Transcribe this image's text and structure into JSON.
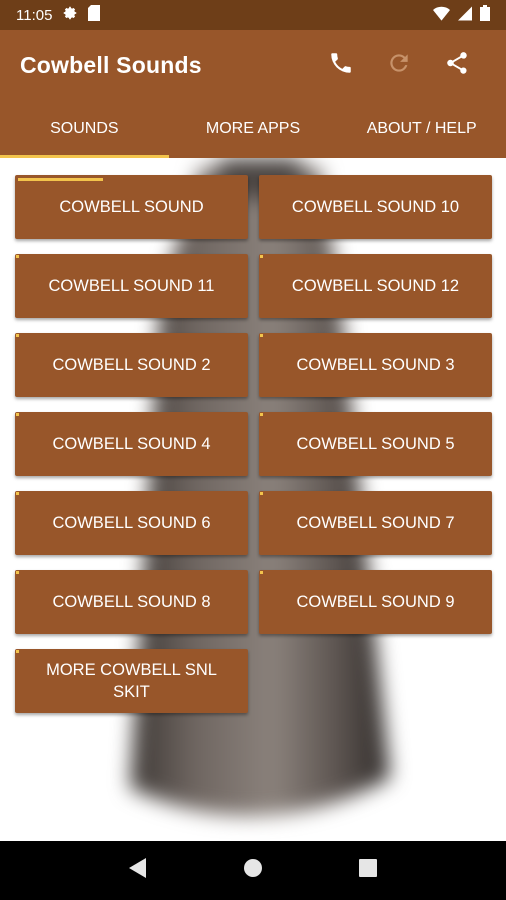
{
  "status_bar": {
    "time": "11:05"
  },
  "app_bar": {
    "title": "Cowbell Sounds"
  },
  "tabs": [
    {
      "label": "SOUNDS",
      "active": true
    },
    {
      "label": "MORE APPS",
      "active": false
    },
    {
      "label": "ABOUT / HELP",
      "active": false
    }
  ],
  "sounds": [
    {
      "label": "COWBELL SOUND"
    },
    {
      "label": "COWBELL SOUND 10"
    },
    {
      "label": "COWBELL SOUND 11"
    },
    {
      "label": "COWBELL SOUND 12"
    },
    {
      "label": "COWBELL SOUND 2"
    },
    {
      "label": "COWBELL SOUND 3"
    },
    {
      "label": "COWBELL SOUND 4"
    },
    {
      "label": "COWBELL SOUND 5"
    },
    {
      "label": "COWBELL SOUND 6"
    },
    {
      "label": "COWBELL SOUND 7"
    },
    {
      "label": "COWBELL SOUND 8"
    },
    {
      "label": "COWBELL SOUND 9"
    },
    {
      "label": "MORE COWBELL SNL SKIT"
    }
  ],
  "colors": {
    "primary": "#98562a",
    "status_bar": "#6e3e18",
    "accent": "#f3c44c"
  },
  "icons": {
    "call": "phone-icon",
    "refresh": "refresh-icon",
    "share": "share-icon"
  }
}
